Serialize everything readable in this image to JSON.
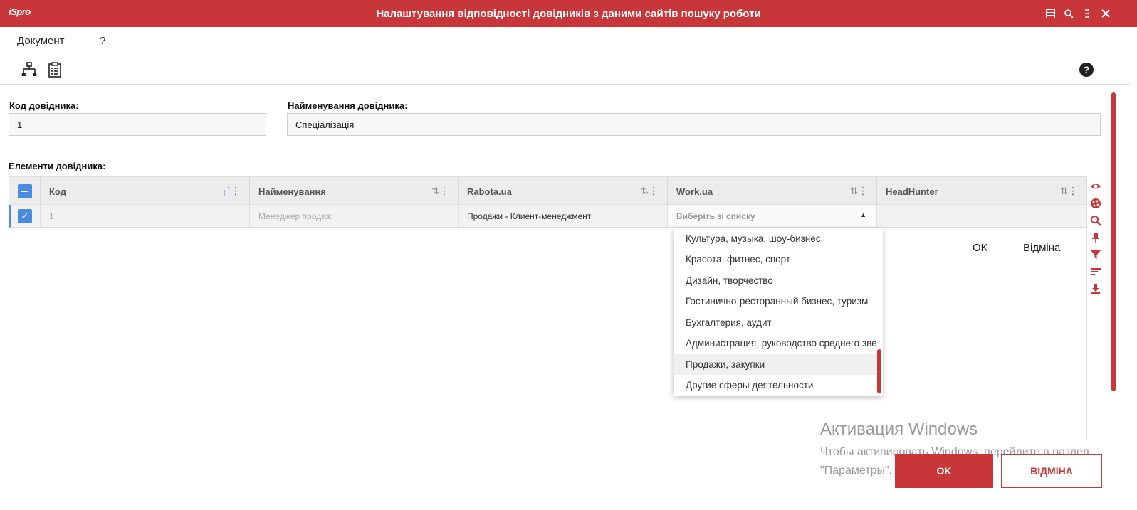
{
  "app": {
    "logo": "iSpro",
    "title": "Налаштування відповідності довідників з даними сайтів пошуку роботи",
    "window_icons": [
      "grid-icon",
      "search-icon",
      "dots-vertical-icon",
      "close-icon"
    ]
  },
  "menu": {
    "items": [
      "Документ",
      "?"
    ]
  },
  "toolbar": {
    "icons": [
      "hierarchy-icon",
      "clipboard-list-icon",
      "help-icon"
    ]
  },
  "form": {
    "code_label": "Код довідника:",
    "code_value": "1",
    "name_label": "Найменування довідника:",
    "name_value": "Спеціалізація",
    "elements_label": "Елементи довідника:"
  },
  "grid": {
    "columns": [
      {
        "label": "Код",
        "sort_badge": "1"
      },
      {
        "label": "Найменування"
      },
      {
        "label": "Rabota.ua"
      },
      {
        "label": "Work.ua"
      },
      {
        "label": "HeadHunter"
      }
    ],
    "rows": [
      {
        "code": "1",
        "name": "Менеджер продаж",
        "rabota": "Продажи - Клиент-менеджмент",
        "work_placeholder": "Виберіть зі списку",
        "headhunter": ""
      }
    ],
    "editor_ok": "OK",
    "editor_cancel": "Відміна"
  },
  "dropdown": {
    "items": [
      "Культура, музыка, шоу-бизнес",
      "Красота, фитнес, спорт",
      "Дизайн, творчество",
      "Гостинично-ресторанный бизнес, туризм",
      "Бухгалтерия, аудит",
      "Администрация, руководство среднего звена",
      "Продажи, закупки",
      "Другие сферы деятельности"
    ],
    "selected_index": 6
  },
  "side_tools": [
    "eye-icon",
    "palette-icon",
    "search-icon",
    "pin-icon",
    "filter-icon",
    "sort-icon",
    "download-icon"
  ],
  "watermark": {
    "title": "Активация Windows",
    "text": "Чтобы активировать Windows, перейдите в раздел \"Параметры\"."
  },
  "buttons": {
    "ok": "OK",
    "cancel": "ВІДМІНА"
  },
  "colors": {
    "accent": "#c8363a",
    "checkbox": "#4a8de0"
  }
}
